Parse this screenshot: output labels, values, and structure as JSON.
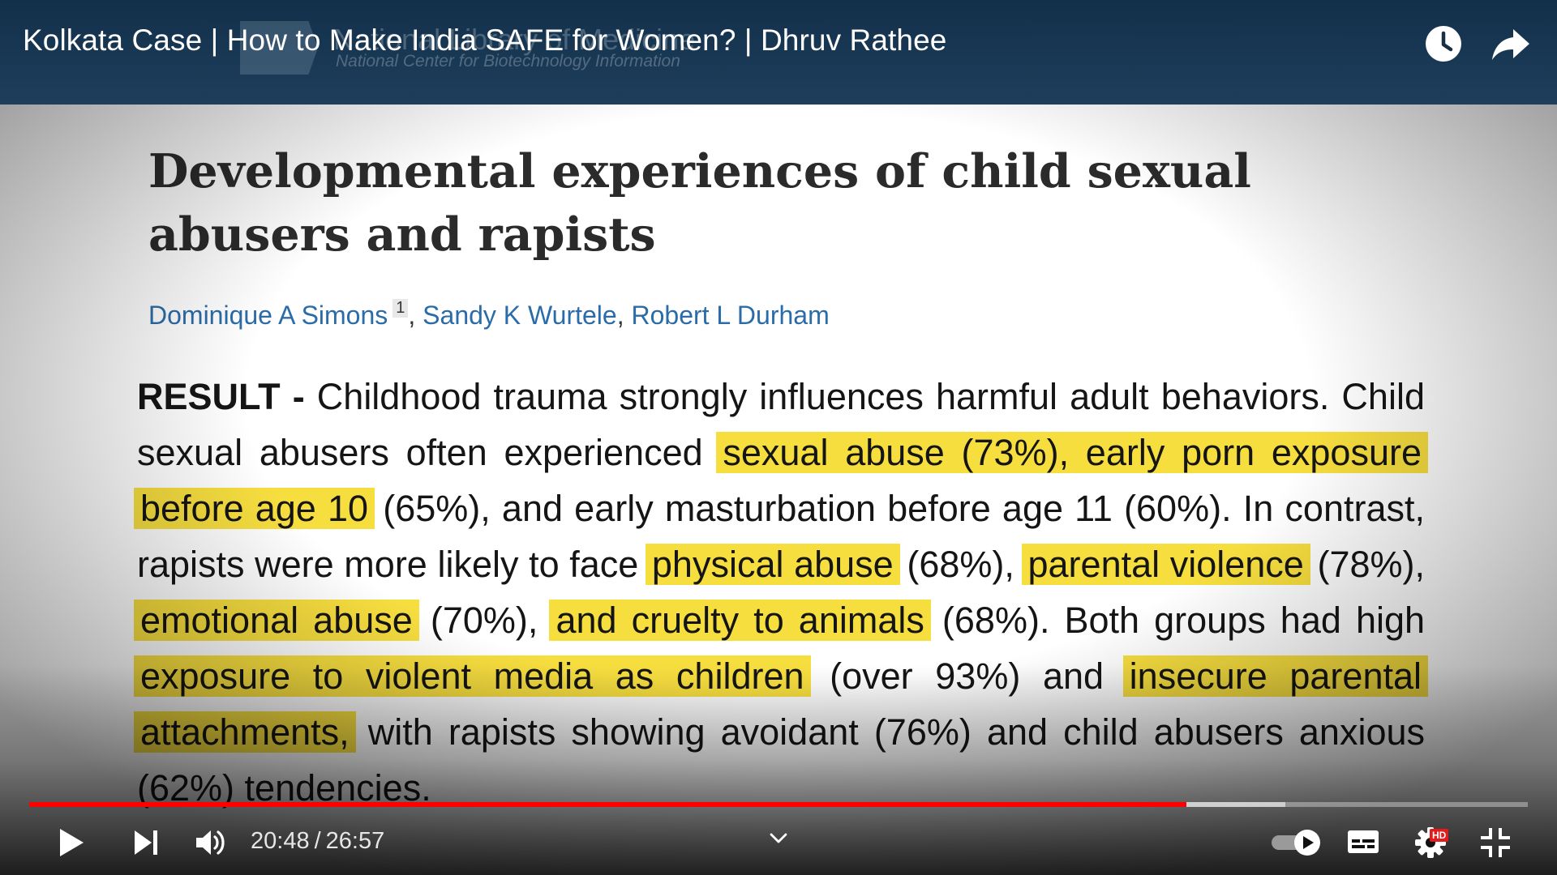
{
  "video": {
    "title": "Kolkata Case | How to Make India SAFE for Women? | Dhruv Rathee",
    "background_org": "National Library of Medicine",
    "background_org_sub": "National Center for Biotechnology Information"
  },
  "paper": {
    "title": "Developmental experiences of child sexual abusers and rapists",
    "authors": [
      {
        "name": "Dominique A Simons",
        "affiliation": "1"
      },
      {
        "name": "Sandy K Wurtele"
      },
      {
        "name": "Robert L Durham"
      }
    ],
    "result_label": "RESULT -",
    "result_segments": [
      {
        "text": " Childhood trauma strongly influences harmful adult behaviors. Child sexual abusers often experienced ",
        "highlight": false
      },
      {
        "text": "sexual abuse (73%), early porn exposure before age 10",
        "highlight": true
      },
      {
        "text": " (65%), and early masturbation before age 11 (60%). In contrast, rapists were more likely to face ",
        "highlight": false
      },
      {
        "text": "physical abuse",
        "highlight": true
      },
      {
        "text": " (68%), ",
        "highlight": false
      },
      {
        "text": "parental violence",
        "highlight": true
      },
      {
        "text": " (78%), ",
        "highlight": false
      },
      {
        "text": "emotional abuse",
        "highlight": true
      },
      {
        "text": " (70%), ",
        "highlight": false
      },
      {
        "text": "and cruelty to animals",
        "highlight": true
      },
      {
        "text": " (68%). Both groups had high ",
        "highlight": false
      },
      {
        "text": "exposure to violent media as children",
        "highlight": true
      },
      {
        "text": " (over 93%) and ",
        "highlight": false
      },
      {
        "text": "insecure parental attachments,",
        "highlight": true
      },
      {
        "text": " with rapists showing avoidant (76%) and child abusers anxious (62%) tendencies.",
        "highlight": false
      }
    ],
    "highlight_color": "#f7de3f",
    "author_link_color": "#2b6ca8"
  },
  "player": {
    "current_time": "20:48",
    "separator": "/",
    "duration": "26:57",
    "played_fraction": 0.772,
    "buffered_fraction": 0.838,
    "progress_color": "#ff0000",
    "quality_badge": "HD",
    "autoplay": "on",
    "icons": {
      "watch_later": "clock-icon",
      "share": "share-arrow-icon",
      "play": "play-icon",
      "next": "next-icon",
      "volume": "volume-icon",
      "chapters": "chevron-down-icon",
      "autoplay": "autoplay-toggle-icon",
      "subtitles": "subtitles-icon",
      "settings": "gear-icon",
      "exit_fullscreen": "exit-fullscreen-icon"
    }
  }
}
